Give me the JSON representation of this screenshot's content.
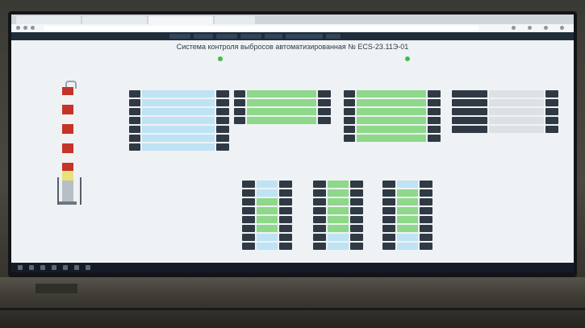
{
  "app": {
    "title": "Система контроля выбросов автоматизированная № ECS-23.11Э-01"
  },
  "colors": {
    "nav_background": "#1f2c3a",
    "label_cell": "#303a45",
    "value_blue": "#bfe3f4",
    "value_green": "#8ed88a",
    "status_ok": "#3fbf4a",
    "page_background": "#eef2f5"
  },
  "icons": {
    "status": "circle",
    "stack": "chimney-stack-illustration"
  }
}
